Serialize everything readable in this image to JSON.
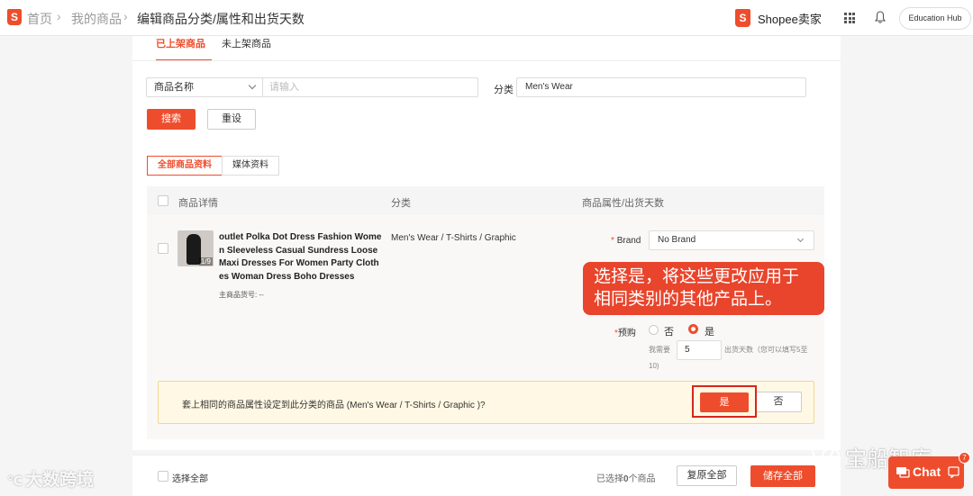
{
  "header": {
    "breadcrumbs": [
      "首页",
      "我的商品",
      "编辑商品分类/属性和出货天数"
    ],
    "brand_name": "Shopee卖家",
    "education_hub": "Education Hub"
  },
  "tabs": [
    "已上架商品",
    "未上架商品"
  ],
  "filter": {
    "field_select": "商品名称",
    "search_placeholder": "请输入",
    "category_label": "分类",
    "category_value": "Men's Wear",
    "search_button": "搜索",
    "reset_button": "重设"
  },
  "subtabs": [
    "全部商品资料",
    "媒体资料"
  ],
  "table": {
    "headers": [
      "商品详情",
      "分类",
      "商品属性/出货天数"
    ],
    "row": {
      "image_count": "1/9",
      "name": "outlet Polka Dot Dress Fashion Women Sleeveless Casual Sundress Loose Maxi Dresses For Women Party Clothes Woman Dress Boho Dresses",
      "sku": "主商品货号: --",
      "category": "Men's Wear / T-Shirts / Graphic",
      "brand_required": "*",
      "brand_label": "Brand",
      "brand_value": "No Brand",
      "preorder_required": "*",
      "preorder_label": "预购",
      "option_no": "否",
      "option_yes": "是",
      "days_prefix": "我需要",
      "days_value": "5",
      "days_suffix": "出货天数（您可以填写5至",
      "days_suffix2": "10)"
    }
  },
  "confirm": {
    "question": "套上相同的商品属性设定到此分类的商品 (Men's Wear / T-Shirts / Graphic )?",
    "yes": "是",
    "no": "否"
  },
  "callout": {
    "line1": "选择是，将这些更改应用于",
    "line2": "相同类别的其他产品上。"
  },
  "footer": {
    "select_all": "选择全部",
    "selected_prefix": "已选择",
    "selected_count": "0",
    "selected_suffix": "个商品",
    "restore_all": "复原全部",
    "save_all": "储存全部"
  },
  "chat": {
    "label": "Chat",
    "badge": "7"
  },
  "watermarks": {
    "left": "大数跨境",
    "right": "宝船智库"
  },
  "colors": {
    "accent": "#ee4d2d",
    "banner_bg": "#fff8e4",
    "highlight_outline": "#d7261c"
  }
}
